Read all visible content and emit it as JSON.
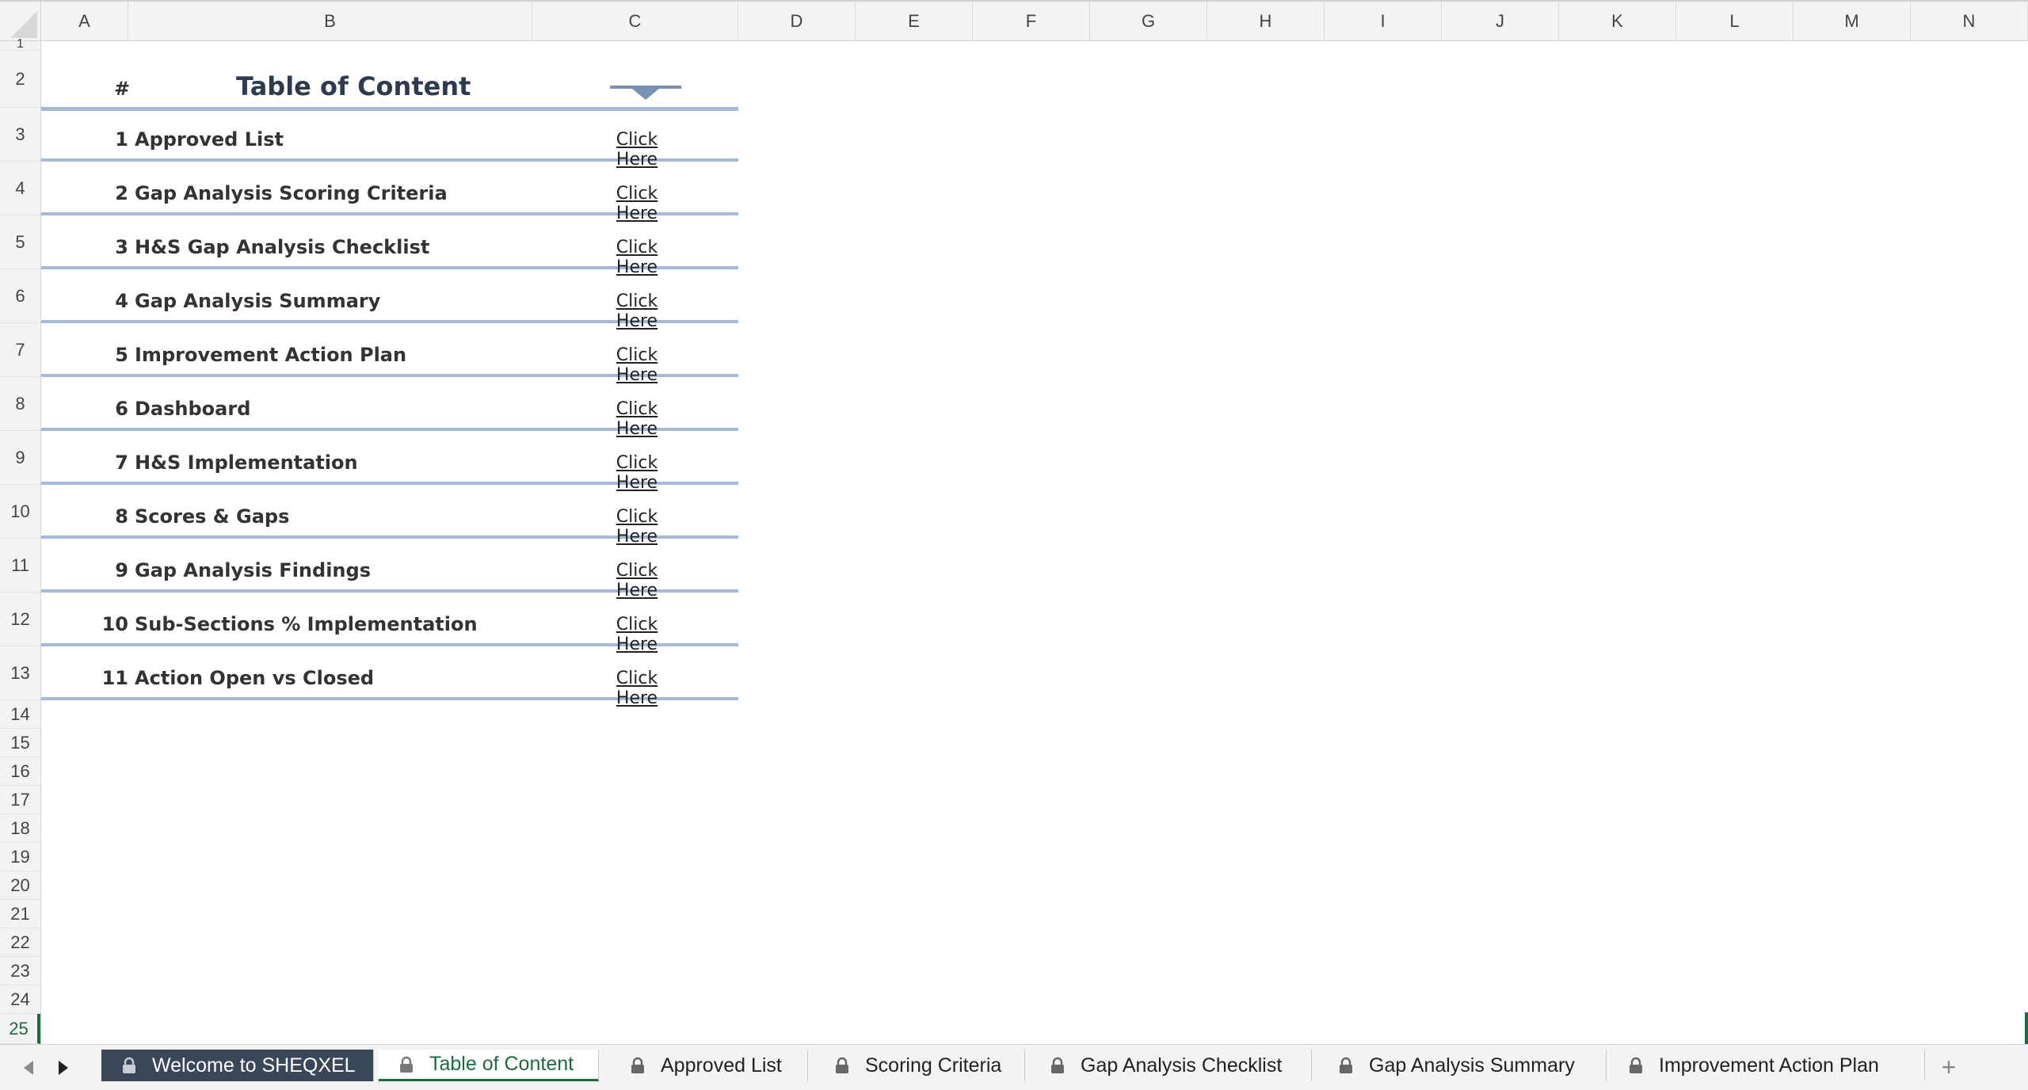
{
  "columns": [
    "A",
    "B",
    "C",
    "D",
    "E",
    "F",
    "G",
    "H",
    "I",
    "J",
    "K",
    "L",
    "M",
    "N"
  ],
  "rows": [
    "1",
    "2",
    "3",
    "4",
    "5",
    "6",
    "7",
    "8",
    "9",
    "10",
    "11",
    "12",
    "13",
    "14",
    "15",
    "16",
    "17",
    "18",
    "19",
    "20",
    "21",
    "22",
    "23",
    "24",
    "25"
  ],
  "active_row": "25",
  "toc": {
    "hash": "#",
    "title": "Table of Content",
    "items": [
      {
        "num": "1",
        "label": "Approved List",
        "link": "Click Here"
      },
      {
        "num": "2",
        "label": "Gap Analysis Scoring Criteria",
        "link": "Click Here"
      },
      {
        "num": "3",
        "label": "H&S Gap Analysis Checklist",
        "link": "Click Here"
      },
      {
        "num": "4",
        "label": "Gap Analysis Summary",
        "link": "Click Here"
      },
      {
        "num": "5",
        "label": "Improvement Action Plan",
        "link": "Click Here"
      },
      {
        "num": "6",
        "label": "Dashboard",
        "link": "Click Here"
      },
      {
        "num": "7",
        "label": "H&S Implementation",
        "link": "Click Here"
      },
      {
        "num": "8",
        "label": "Scores & Gaps",
        "link": "Click Here"
      },
      {
        "num": "9",
        "label": "Gap Analysis Findings",
        "link": "Click Here"
      },
      {
        "num": "10",
        "label": "Sub-Sections % Implementation",
        "link": "Click Here"
      },
      {
        "num": "11",
        "label": "Action Open vs Closed",
        "link": "Click Here"
      }
    ]
  },
  "tabs": [
    {
      "label": "Welcome to SHEQXEL",
      "icon": "lock-icon",
      "state": "dark"
    },
    {
      "label": "Table of Content",
      "icon": "lock-icon",
      "state": "active"
    },
    {
      "label": "Approved List",
      "icon": "lock-icon",
      "state": "normal"
    },
    {
      "label": "Scoring Criteria",
      "icon": "lock-icon",
      "state": "normal"
    },
    {
      "label": "Gap Analysis Checklist",
      "icon": "lock-icon",
      "state": "normal"
    },
    {
      "label": "Gap Analysis Summary",
      "icon": "lock-icon",
      "state": "normal"
    },
    {
      "label": "Improvement Action Plan",
      "icon": "lock-icon",
      "state": "normal"
    }
  ],
  "add_sheet_label": "+",
  "colors": {
    "accent": "#1d6b3b",
    "divider": "#a5b8d8",
    "dark_tab": "#3a4758",
    "arrow": "#7a91b4"
  }
}
